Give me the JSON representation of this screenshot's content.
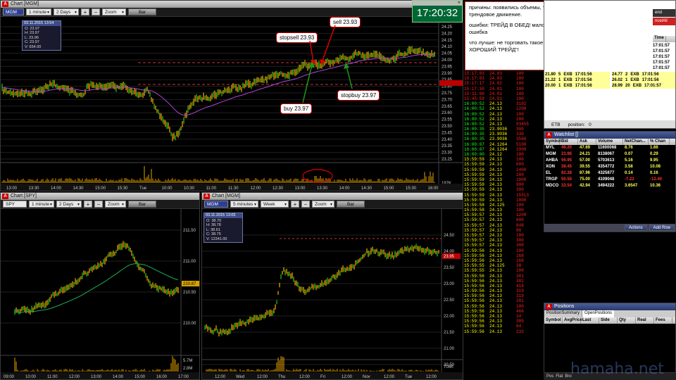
{
  "mgm_top": {
    "title": "Chart [MGM]",
    "symbol": "MGM",
    "interval": "1 minute",
    "range": "2 Days",
    "zoom": "Zoom",
    "bar_label": "Bar",
    "ohlc": {
      "date": "03.11.2015 13:54",
      "o": "O: 23.97",
      "h": "H: 23.97",
      "l": "L: 23.96",
      "c": "C: 23.97",
      "v": "V: 654.00"
    },
    "yticks": [
      "24.25",
      "24.20",
      "24.15",
      "24.10",
      "24.05",
      "24.00",
      "23.95",
      "23.90",
      "23.85",
      "23.80",
      "23.75",
      "23.70",
      "23.65",
      "23.60",
      "23.55",
      "23.50",
      "23.45",
      "23.40",
      "23.35",
      "23.30",
      "23.25"
    ],
    "vol_ticks": [
      "187K"
    ],
    "xticks": [
      "13:00",
      "13:30",
      "14:00",
      "14:30",
      "15:00",
      "15:30",
      "Tue",
      "10:00",
      "10:30",
      "11:00",
      "11:30",
      "12:00",
      "12:30",
      "13:00",
      "13:30",
      "14:00",
      "14:30",
      "15:00",
      "15:30",
      "16:00"
    ]
  },
  "annotations": {
    "stopsell": "stopsell 23.93",
    "sell": "sell 23.93",
    "buy": "buy 23.97",
    "stopbuy": "stopbuy 23.97"
  },
  "clock": {
    "time": "17:20:32"
  },
  "note": {
    "line1": "причины:   появились объемы, тренд, заходил на откате, надеялся на трендовое движение.",
    "line2": "ошибки:   ТРЕЙД В ОБЕД! мало сигналов для входа, второй трейд - ошибка",
    "line3": "что лучше:   не торговать такое в обед.  делать каждый раз \"ОДИН ХОРОШИЙ ТРЕЙД\"!"
  },
  "spy": {
    "title": "Chart [SPY]",
    "symbol": "SPY",
    "interval": "1 minute",
    "range": "2 Days",
    "zoom": "Zoom",
    "bar_label": "Bar",
    "yticks": [
      "211.50",
      "211.00",
      "210.50",
      "210.00"
    ],
    "last": "210.87",
    "vol_ticks": [
      "5.7M",
      "2.8M"
    ],
    "xticks": [
      "09:00",
      "10:00",
      "11:00",
      "12:00",
      "13:00",
      "14:00",
      "15:00",
      "16:00",
      "17:00"
    ]
  },
  "mgm_bot": {
    "title": "Chart [MGM]",
    "symbol": "MGM",
    "interval": "5 minutes",
    "range": "Week",
    "zoom": "Zoom",
    "bar_label": "Bar",
    "ohlc": {
      "date": "03.11.2015 13:05",
      "o": "O: 38.70",
      "h": "H: 38.78",
      "l": "L: 38.61",
      "c": "C: 38.75",
      "v": "V: 12341.00"
    },
    "yticks": [
      "24.50",
      "24.00",
      "23.50",
      "23.00",
      "22.50",
      "22.00",
      "21.50",
      "21.00",
      "20.50"
    ],
    "last": "23.95",
    "vol_ticks": [
      "706K"
    ],
    "xticks": [
      "12:00",
      "Wed",
      "12:00",
      "Thu",
      "12:00",
      "Fri",
      "12:00",
      "Nov",
      "12:00",
      "Tue",
      "12:00"
    ]
  },
  "tape": {
    "rows": [
      [
        "15:17:03",
        "24.03",
        "100"
      ],
      [
        "15:17:03",
        "24.03",
        "100"
      ],
      [
        "15:17:17",
        "24.02",
        "100"
      ],
      [
        "15:17:30",
        "24.01",
        "100"
      ],
      [
        "15:31:00",
        "24.01",
        "100"
      ],
      [
        "15:45:59",
        "24.01",
        "100"
      ],
      [
        "16:00:52",
        "24.13",
        "3102"
      ],
      [
        "16:00:52",
        "24.13",
        "2200"
      ],
      [
        "16:00:52",
        "24.13",
        "100"
      ],
      [
        "16:00:52",
        "24.13",
        "200"
      ],
      [
        "16:00:52",
        "24.13",
        "93455"
      ],
      [
        "16:00:35",
        "23.9036",
        "300"
      ],
      [
        "16:00:35",
        "23.9036",
        "330"
      ],
      [
        "16:00:35",
        "23.9036",
        "3566"
      ],
      [
        "16:00:07",
        "24.1264",
        "5100"
      ],
      [
        "16:00:07",
        "24.1264",
        "2900"
      ],
      [
        "16:00:00",
        "24.12",
        "100"
      ],
      [
        "15:59:59",
        "24.13",
        "100"
      ],
      [
        "15:59:59",
        "24.13",
        "600"
      ],
      [
        "15:59:59",
        "24.13",
        "2400"
      ],
      [
        "15:59:59",
        "24.13",
        "100"
      ],
      [
        "15:59:59",
        "24.13",
        "1000"
      ],
      [
        "15:59:59",
        "24.13",
        "900"
      ],
      [
        "15:59:59",
        "24.13",
        "300"
      ],
      [
        "15:59:59",
        "24.13",
        "15513"
      ],
      [
        "15:59:59",
        "24.13",
        "1000"
      ],
      [
        "15:59:58",
        "24.125",
        "100"
      ],
      [
        "15:59:58",
        "24.13",
        "100"
      ],
      [
        "15:59:57",
        "24.13",
        "1200"
      ],
      [
        "15:59:57",
        "24.13",
        "600"
      ],
      [
        "15:59:57",
        "24.13",
        "848"
      ],
      [
        "15:59:57",
        "24.13",
        "86"
      ],
      [
        "15:59:57",
        "24.13",
        "100"
      ],
      [
        "15:59:57",
        "24.13",
        "300"
      ],
      [
        "15:59:57",
        "24.13",
        "300"
      ],
      [
        "15:59:56",
        "24.13",
        "100"
      ],
      [
        "15:59:56",
        "24.13",
        "168"
      ],
      [
        "15:59:56",
        "24.13",
        "168"
      ],
      [
        "15:59:55",
        "24.125",
        "38"
      ],
      [
        "15:59:55",
        "24.13",
        "100"
      ],
      [
        "15:59:56",
        "24.13",
        "381"
      ],
      [
        "15:59:56",
        "24.13",
        "381"
      ],
      [
        "15:59:56",
        "24.13",
        "419"
      ],
      [
        "15:59:56",
        "24.13",
        "319"
      ],
      [
        "15:59:56",
        "24.13",
        "319"
      ],
      [
        "15:59:56",
        "24.13",
        "281"
      ],
      [
        "15:59:56",
        "24.13",
        "100"
      ],
      [
        "15:59:56",
        "24.13",
        "466"
      ],
      [
        "15:59:56",
        "24.13",
        "14"
      ],
      [
        "15:59:56",
        "24.13",
        "385"
      ],
      [
        "15:59:56",
        "24.13",
        "64"
      ],
      [
        "15:59:56",
        "24.13",
        "233"
      ]
    ]
  },
  "level2": {
    "cols": [
      "Time"
    ],
    "times": [
      "17:01:57",
      "17:01:57",
      "17:01:57",
      "17:01:57",
      "17:01:57"
    ],
    "bid": [
      [
        "21.80",
        "5",
        "EXB",
        "17:01:56"
      ],
      [
        "21.22",
        "1",
        "EXB",
        "17:01:56"
      ],
      [
        "20.00",
        "1",
        "EXB",
        "17:01:56"
      ]
    ],
    "ask": [
      [
        "24.77",
        "2",
        "EXB",
        "17:01:56"
      ],
      [
        "26.02",
        "1",
        "EXB",
        "17:01:56"
      ],
      [
        "28.99",
        "20",
        "EXB",
        "17:01:57"
      ]
    ],
    "etb": "ETB",
    "position_label": "position:",
    "position": "0",
    "btn1": "end",
    "btn2": "ncelAll"
  },
  "watchlist": {
    "title": "Watchlist []",
    "cols": [
      "Symbol",
      "Bid",
      "Ask",
      "Volume",
      "NetChan...",
      "% Chan"
    ],
    "rows": [
      [
        "MYL",
        "46.20",
        "47.69",
        "11600068",
        "8.76",
        "1.66"
      ],
      [
        "MGM",
        "23.86",
        "24.21",
        "8138067",
        "0.07",
        "0.29"
      ],
      [
        "AHBA",
        "56.95",
        "57.00",
        "5703613",
        "5.16",
        "9.95"
      ],
      [
        "XON",
        "38.45",
        "39.55",
        "4354772",
        "3.58",
        "10.08"
      ],
      [
        "EL",
        "82.38",
        "87.96",
        "4325877",
        "0.14",
        "0.16"
      ],
      [
        "TRGP",
        "50.55",
        "75.00",
        "4109048",
        "-7.22",
        "-12.40"
      ],
      [
        "MDCO",
        "33.54",
        "42.94",
        "3494222",
        "3.6547",
        "10.36"
      ]
    ],
    "actions": "Actions",
    "add_row": "Add Row"
  },
  "positions": {
    "title": "Positions",
    "tabs": [
      "PositionSummary",
      "OpenPositions"
    ],
    "cols": [
      "Symbol",
      "AvgPrice",
      "Last",
      "Side",
      "Qty",
      "Real",
      "Fees"
    ]
  },
  "taskbar": {
    "items": [
      "Pos",
      "Flat",
      "Bro"
    ]
  },
  "watermark": "hamaha.net"
}
